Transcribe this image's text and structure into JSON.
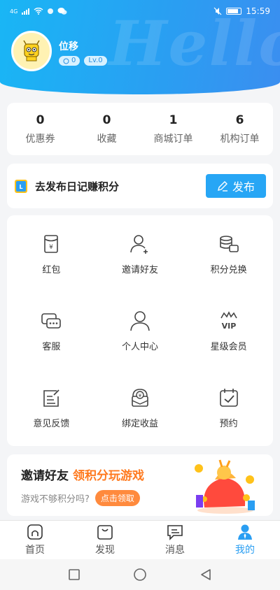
{
  "status_bar": {
    "time": "15:59",
    "network": "4G"
  },
  "header": {
    "watermark": "Hello"
  },
  "user": {
    "name": "位移",
    "points": "0",
    "level": "Lv.0"
  },
  "stats": [
    {
      "value": "0",
      "label": "优惠券"
    },
    {
      "value": "0",
      "label": "收藏"
    },
    {
      "value": "1",
      "label": "商城订单"
    },
    {
      "value": "6",
      "label": "机构订单"
    }
  ],
  "diary": {
    "text": "去发布日记赚积分",
    "button": "发布"
  },
  "grid": [
    {
      "label": "红包",
      "icon": "red-envelope-icon"
    },
    {
      "label": "邀请好友",
      "icon": "add-user-icon"
    },
    {
      "label": "积分兑换",
      "icon": "coins-icon"
    },
    {
      "label": "客服",
      "icon": "chat-icon"
    },
    {
      "label": "个人中心",
      "icon": "person-icon"
    },
    {
      "label": "星级会员",
      "icon": "vip-crown-icon"
    },
    {
      "label": "意见反馈",
      "icon": "feedback-icon"
    },
    {
      "label": "绑定收益",
      "icon": "bind-income-icon"
    },
    {
      "label": "预约",
      "icon": "calendar-check-icon"
    }
  ],
  "invite": {
    "title": "邀请好友",
    "highlight": "领积分玩游戏",
    "subtitle": "游戏不够积分吗?",
    "button": "点击领取"
  },
  "tabs": [
    {
      "label": "首页",
      "icon": "home-icon"
    },
    {
      "label": "发现",
      "icon": "shopping-bag-icon"
    },
    {
      "label": "消息",
      "icon": "message-icon"
    },
    {
      "label": "我的",
      "icon": "profile-icon",
      "active": true
    }
  ],
  "colors": {
    "accent": "#2a9ef2",
    "orange": "#ff7a1f"
  }
}
